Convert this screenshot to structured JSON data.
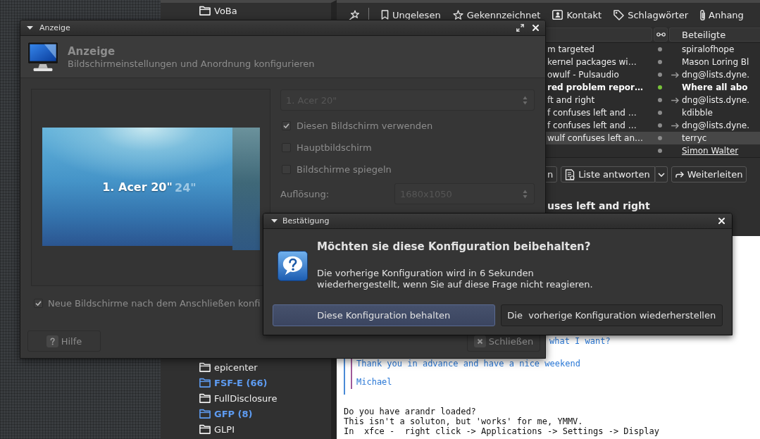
{
  "mail_window": {
    "folders_top": [
      {
        "name": "VoBa",
        "unread": false
      }
    ],
    "folders_bottom": [
      {
        "name": "epicenter",
        "unread": false
      },
      {
        "name": "FSF-E (66)",
        "unread": true
      },
      {
        "name": "FullDisclosure",
        "unread": false
      },
      {
        "name": "GFP (8)",
        "unread": true
      },
      {
        "name": "GLPI",
        "unread": false
      }
    ],
    "filter_bar": [
      {
        "kind": "unread",
        "label": "Ungelesen"
      },
      {
        "kind": "flagged",
        "label": "Gekennzeichnet"
      },
      {
        "kind": "contact",
        "label": "Kontakt"
      },
      {
        "kind": "tags",
        "label": "Schlagwörter"
      },
      {
        "kind": "attachment",
        "label": "Anhang"
      }
    ],
    "thread_list": {
      "correspondents_heading": "Beteiligte",
      "rows": [
        {
          "subject": "m targeted",
          "color": "#8c8c8c",
          "outgoing": false,
          "correspondent": "spiralofhope",
          "unread": false,
          "selected": false,
          "hovered": false
        },
        {
          "subject": "kernel packages wi…",
          "color": "#8c8c8c",
          "outgoing": false,
          "correspondent": "Mason Loring Bl",
          "unread": false,
          "selected": false,
          "hovered": false
        },
        {
          "subject": "owulf - Pulsaudio",
          "color": "#8c8c8c",
          "outgoing": true,
          "correspondent": "dng@lists.dyne.",
          "unread": false,
          "selected": false,
          "hovered": false
        },
        {
          "subject": "red problem repor…",
          "color": "#78c23a",
          "outgoing": false,
          "correspondent": "Where all abo",
          "unread": true,
          "selected": false,
          "hovered": false
        },
        {
          "subject": "ft and right",
          "color": "#8c8c8c",
          "outgoing": true,
          "correspondent": "dng@lists.dyne.",
          "unread": false,
          "selected": false,
          "hovered": false
        },
        {
          "subject": "f confuses left and …",
          "color": "#8c8c8c",
          "outgoing": false,
          "correspondent": "kdibble",
          "unread": false,
          "selected": false,
          "hovered": false
        },
        {
          "subject": "f confuses left and …",
          "color": "#8c8c8c",
          "outgoing": true,
          "correspondent": "dng@lists.dyne.",
          "unread": false,
          "selected": false,
          "hovered": false
        },
        {
          "subject": "wulf confuses left an…",
          "color": "#8c8c8c",
          "outgoing": false,
          "correspondent": "terryc",
          "unread": false,
          "selected": true,
          "hovered": false
        },
        {
          "color": "#8c8c8c",
          "outgoing": false,
          "correspondent": "Simon Walter",
          "unread": false,
          "selected": false,
          "hovered": true
        }
      ]
    },
    "message": {
      "actions": [
        {
          "kind": "reply",
          "label": "n"
        },
        {
          "kind": "reply-list",
          "label": "Liste antworten"
        },
        {
          "kind": "forward",
          "label": "Weiterleiten"
        }
      ],
      "subject": "uses left and right",
      "quote": {
        "lines": [
          "what I want?",
          "Thank you in advance and have a nice weekend",
          "Michael"
        ]
      },
      "lines": [
        "Do you have arandr loaded?",
        "This isn't a soluton, but 'works' for me, YMMV.",
        "In  xfce -  right click -> Applications -> Settings -> Display"
      ]
    }
  },
  "display_dialog": {
    "title": "Anzeige",
    "inactive": true,
    "heading": "Anzeige",
    "subtitle": "Bildschirmeinstellungen und Anordnung konfigurieren",
    "monitors": [
      {
        "label": "1. Acer 20\"",
        "selected": true
      },
      {
        "label": "24\"",
        "selected": false
      }
    ],
    "output_select": {
      "value": "1. Acer 20\"",
      "disabled": true
    },
    "options": [
      {
        "label": "Diesen Bildschirm verwenden",
        "checked": true
      },
      {
        "label": "Hauptbildschirm",
        "checked": false
      },
      {
        "label": "Bildschirme spiegeln",
        "checked": false
      }
    ],
    "resolution": {
      "label": "Auflösung:",
      "value": "1680x1050",
      "disabled": true
    },
    "auto_configure": {
      "label": "Neue Bildschirme nach dem Anschließen konfi",
      "checked": true
    },
    "buttons": [
      {
        "kind": "help",
        "label": "Hilfe"
      },
      {
        "kind": "close",
        "label": "Schließen"
      }
    ]
  },
  "confirm_dialog": {
    "title": "Bestätigung",
    "heading": "Möchten sie diese Konfiguration beibehalten?",
    "message": "Die vorherige Konfiguration wird in 6 Sekunden\nwiederhergestellt, wenn Sie auf diese Frage nicht reagieren.",
    "buttons": [
      {
        "label": "Diese Konfiguration behalten",
        "default": true
      },
      {
        "label": "Die  vorherige Konfiguration wiederherstellen",
        "default": false
      }
    ]
  }
}
